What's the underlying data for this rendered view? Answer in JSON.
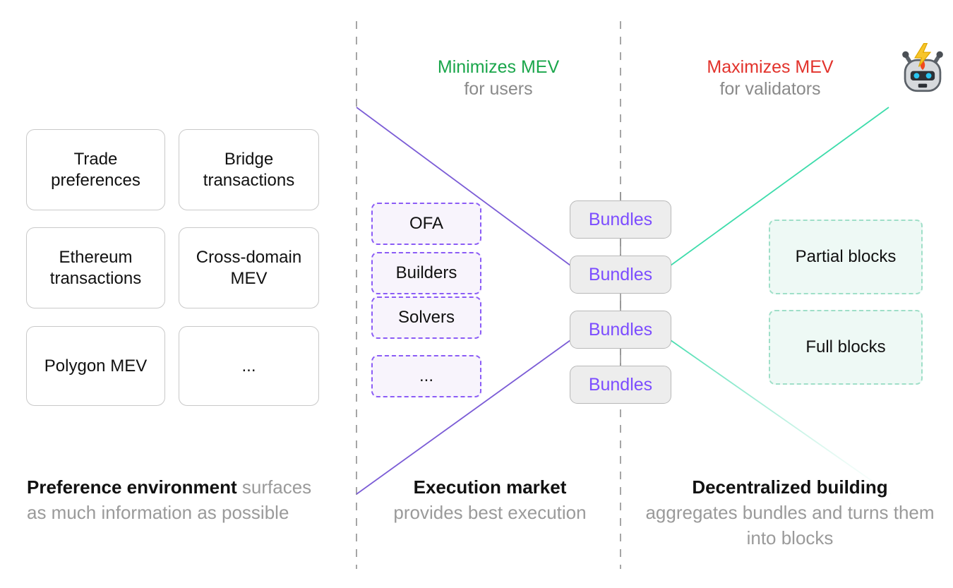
{
  "colors": {
    "minimize_accent": "#1aa64b",
    "maximize_accent": "#e2322b",
    "bundle_text": "#7c4dff",
    "market_dash": "#8b5cf6",
    "block_dash": "#9fdfc8",
    "divider": "#8f8f8f",
    "muted_text": "#9a9a9a"
  },
  "headers": {
    "minimize": {
      "line1": "Minimizes MEV",
      "line2": "for users"
    },
    "maximize": {
      "line1": "Maximizes MEV",
      "line2": "for validators"
    }
  },
  "robot": {
    "icon": "robot-icon",
    "label": "robot-with-lightning-bolt"
  },
  "preference_cards": [
    {
      "lines": [
        "Trade",
        "preferences"
      ]
    },
    {
      "lines": [
        "Bridge",
        "transactions"
      ]
    },
    {
      "lines": [
        "Ethereum",
        "transactions"
      ]
    },
    {
      "lines": [
        "Cross-domain",
        "MEV"
      ]
    },
    {
      "lines": [
        "Polygon MEV"
      ]
    },
    {
      "lines": [
        "..."
      ]
    }
  ],
  "execution_market": {
    "items": [
      {
        "label": "OFA"
      },
      {
        "label": "Builders"
      },
      {
        "label": "Solvers"
      },
      {
        "label": "..."
      }
    ]
  },
  "bundles": {
    "label": "Bundles",
    "items": [
      "Bundles",
      "Bundles",
      "Bundles",
      "Bundles"
    ]
  },
  "blocks": {
    "items": [
      {
        "label": "Partial blocks"
      },
      {
        "label": "Full blocks"
      }
    ]
  },
  "captions": {
    "left": {
      "strong": "Preference environment",
      "rest": " surfaces as much information as possible"
    },
    "middle": {
      "strong": "Execution market",
      "rest": "provides best execution"
    },
    "right": {
      "strong": "Decentralized building",
      "rest": "aggregates bundles and turns them into blocks"
    }
  }
}
